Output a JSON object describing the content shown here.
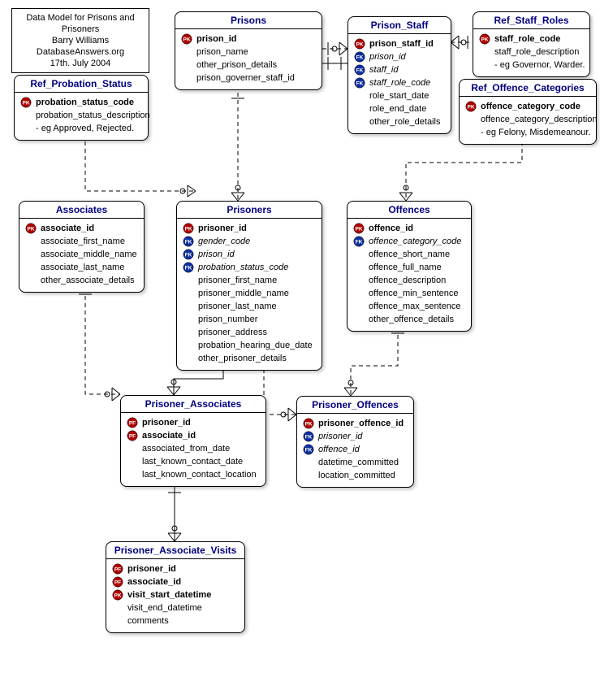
{
  "note": {
    "line1": "Data Model for Prisons and Prisoners",
    "line2": "Barry Williams",
    "line3": "DatabaseAnswers.org",
    "line4": "17th. July 2004"
  },
  "entities": {
    "prisons": {
      "title": "Prisons",
      "attrs": [
        {
          "icon": "pk",
          "name": "prison_id",
          "bold": true
        },
        {
          "icon": "",
          "name": "prison_name"
        },
        {
          "icon": "",
          "name": "other_prison_details"
        },
        {
          "icon": "",
          "name": "prison_governer_staff_id"
        }
      ]
    },
    "prison_staff": {
      "title": "Prison_Staff",
      "attrs": [
        {
          "icon": "pk",
          "name": "prison_staff_id",
          "bold": true
        },
        {
          "icon": "fk",
          "name": "prison_id",
          "italic": true
        },
        {
          "icon": "fk",
          "name": "staff_id",
          "italic": true
        },
        {
          "icon": "fk",
          "name": "staff_role_code",
          "italic": true
        },
        {
          "icon": "",
          "name": "role_start_date"
        },
        {
          "icon": "",
          "name": "role_end_date"
        },
        {
          "icon": "",
          "name": "other_role_details"
        }
      ]
    },
    "ref_staff_roles": {
      "title": "Ref_Staff_Roles",
      "attrs": [
        {
          "icon": "pk",
          "name": "staff_role_code",
          "bold": true
        },
        {
          "icon": "",
          "name": "staff_role_description"
        },
        {
          "icon": "",
          "name": "- eg Governor, Warder."
        }
      ]
    },
    "ref_probation_status": {
      "title": "Ref_Probation_Status",
      "attrs": [
        {
          "icon": "pk",
          "name": "probation_status_code",
          "bold": true
        },
        {
          "icon": "",
          "name": "probation_status_description"
        },
        {
          "icon": "",
          "name": "- eg Approved, Rejected."
        }
      ]
    },
    "ref_offence_categories": {
      "title": "Ref_Offence_Categories",
      "attrs": [
        {
          "icon": "pk",
          "name": "offence_category_code",
          "bold": true
        },
        {
          "icon": "",
          "name": "offence_category_description"
        },
        {
          "icon": "",
          "name": "- eg Felony, Misdemeanour."
        }
      ]
    },
    "associates": {
      "title": "Associates",
      "attrs": [
        {
          "icon": "pk",
          "name": "associate_id",
          "bold": true
        },
        {
          "icon": "",
          "name": "associate_first_name"
        },
        {
          "icon": "",
          "name": "associate_middle_name"
        },
        {
          "icon": "",
          "name": "associate_last_name"
        },
        {
          "icon": "",
          "name": "other_associate_details"
        }
      ]
    },
    "prisoners": {
      "title": "Prisoners",
      "attrs": [
        {
          "icon": "pk",
          "name": "prisoner_id",
          "bold": true
        },
        {
          "icon": "fk",
          "name": "gender_code",
          "italic": true
        },
        {
          "icon": "fk",
          "name": "prison_id",
          "italic": true
        },
        {
          "icon": "fk",
          "name": "probation_status_code",
          "italic": true
        },
        {
          "icon": "",
          "name": "prisoner_first_name"
        },
        {
          "icon": "",
          "name": "prisoner_middle_name"
        },
        {
          "icon": "",
          "name": "prisoner_last_name"
        },
        {
          "icon": "",
          "name": "prison_number"
        },
        {
          "icon": "",
          "name": "prisoner_address"
        },
        {
          "icon": "",
          "name": "probation_hearing_due_date"
        },
        {
          "icon": "",
          "name": "other_prisoner_details"
        }
      ]
    },
    "offences": {
      "title": "Offences",
      "attrs": [
        {
          "icon": "pk",
          "name": "offence_id",
          "bold": true
        },
        {
          "icon": "fk",
          "name": "offence_category_code",
          "italic": true
        },
        {
          "icon": "",
          "name": "offence_short_name"
        },
        {
          "icon": "",
          "name": "offence_full_name"
        },
        {
          "icon": "",
          "name": "offence_description"
        },
        {
          "icon": "",
          "name": "offence_min_sentence"
        },
        {
          "icon": "",
          "name": "offence_max_sentence"
        },
        {
          "icon": "",
          "name": "other_offence_details"
        }
      ]
    },
    "prisoner_associates": {
      "title": "Prisoner_Associates",
      "attrs": [
        {
          "icon": "pf",
          "name": "prisoner_id",
          "bold": true
        },
        {
          "icon": "pf",
          "name": "associate_id",
          "bold": true
        },
        {
          "icon": "",
          "name": "associated_from_date"
        },
        {
          "icon": "",
          "name": "last_known_contact_date"
        },
        {
          "icon": "",
          "name": "last_known_contact_location"
        }
      ]
    },
    "prisoner_offences": {
      "title": "Prisoner_Offences",
      "attrs": [
        {
          "icon": "pk",
          "name": "prisoner_offence_id",
          "bold": true
        },
        {
          "icon": "fk",
          "name": "prisoner_id",
          "italic": true
        },
        {
          "icon": "fk",
          "name": "offence_id",
          "italic": true
        },
        {
          "icon": "",
          "name": "datetime_committed"
        },
        {
          "icon": "",
          "name": "location_committed"
        }
      ]
    },
    "prisoner_associate_visits": {
      "title": "Prisoner_Associate_Visits",
      "attrs": [
        {
          "icon": "pf",
          "name": "prisoner_id",
          "bold": true
        },
        {
          "icon": "pf",
          "name": "associate_id",
          "bold": true
        },
        {
          "icon": "pk",
          "name": "visit_start_datetime",
          "bold": true
        },
        {
          "icon": "",
          "name": "visit_end_datetime"
        },
        {
          "icon": "",
          "name": "comments"
        }
      ]
    }
  },
  "relationships": [
    {
      "from": "prisons",
      "to": "prison_staff",
      "identifying": false
    },
    {
      "from": "prison_staff",
      "to": "prisons",
      "identifying": true
    },
    {
      "from": "ref_staff_roles",
      "to": "prison_staff",
      "identifying": false
    },
    {
      "from": "ref_probation_status",
      "to": "prisoners",
      "identifying": false
    },
    {
      "from": "prisons",
      "to": "prisoners",
      "identifying": false
    },
    {
      "from": "ref_offence_categories",
      "to": "offences",
      "identifying": false
    },
    {
      "from": "associates",
      "to": "prisoner_associates",
      "identifying": false
    },
    {
      "from": "prisoners",
      "to": "prisoner_associates",
      "identifying": true
    },
    {
      "from": "prisoners",
      "to": "prisoner_offences",
      "identifying": false
    },
    {
      "from": "offences",
      "to": "prisoner_offences",
      "identifying": false
    },
    {
      "from": "prisoner_associates",
      "to": "prisoner_associate_visits",
      "identifying": true
    }
  ]
}
